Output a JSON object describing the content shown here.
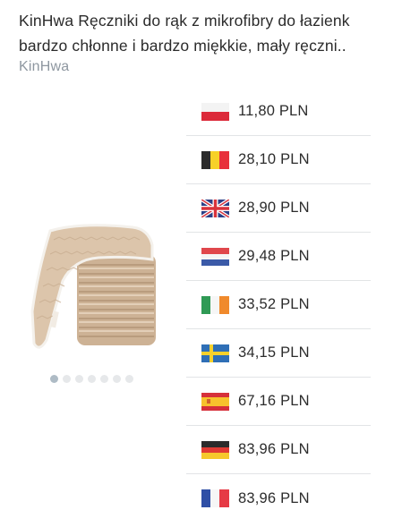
{
  "product": {
    "title_line1": "KinHwa Ręczniki do rąk z mikrofibry do łazienk",
    "title_line2": "bardzo chłonne i bardzo miękkie, mały ręczni..",
    "brand": "KinHwa",
    "image_icon": "towel-stack-image",
    "carousel": {
      "total": 7,
      "active_index": 0
    }
  },
  "prices": [
    {
      "country": "Poland",
      "flag_icon": "poland-flag-icon",
      "price": "11,80 PLN"
    },
    {
      "country": "Belgium",
      "flag_icon": "belgium-flag-icon",
      "price": "28,10 PLN"
    },
    {
      "country": "United Kingdom",
      "flag_icon": "uk-flag-icon",
      "price": "28,90 PLN"
    },
    {
      "country": "Netherlands",
      "flag_icon": "netherlands-flag-icon",
      "price": "29,48 PLN"
    },
    {
      "country": "Ireland",
      "flag_icon": "ireland-flag-icon",
      "price": "33,52 PLN"
    },
    {
      "country": "Sweden",
      "flag_icon": "sweden-flag-icon",
      "price": "34,15 PLN"
    },
    {
      "country": "Spain",
      "flag_icon": "spain-flag-icon",
      "price": "67,16 PLN"
    },
    {
      "country": "Germany",
      "flag_icon": "germany-flag-icon",
      "price": "83,96 PLN"
    },
    {
      "country": "France",
      "flag_icon": "france-flag-icon",
      "price": "83,96 PLN"
    }
  ],
  "colors": {
    "text": "#2b2b2b",
    "brand": "#8e97a0",
    "divider": "#e2e4e6",
    "dot": "#e6e8ea",
    "dot_active": "#aebbc5",
    "towel": "#d8c0a6"
  }
}
